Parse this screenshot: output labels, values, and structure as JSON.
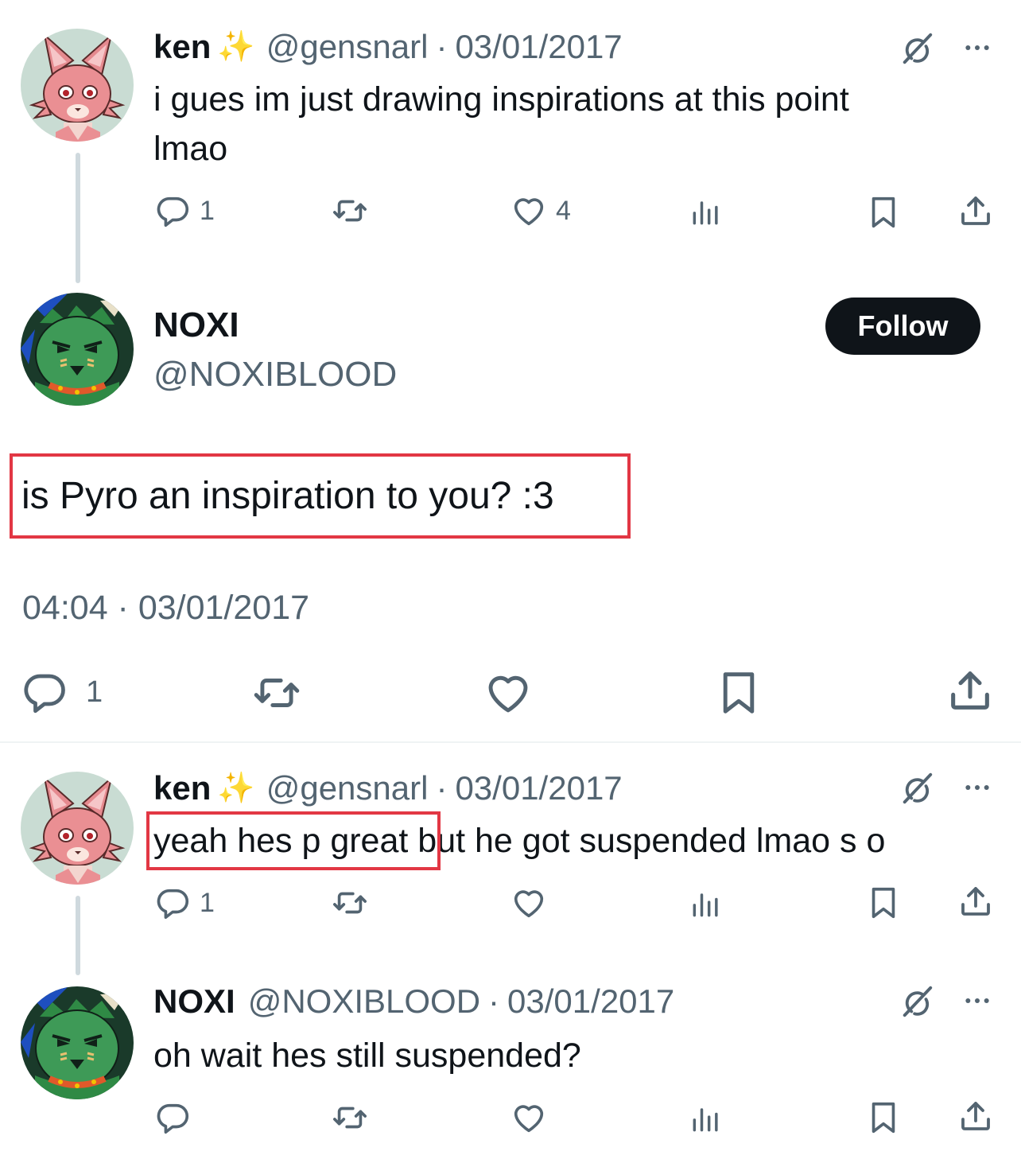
{
  "tweet1": {
    "name": "ken",
    "emoji": "✨",
    "handle": "@gensnarl",
    "dot": "·",
    "date": "03/01/2017",
    "text_line1": "i gues im just drawing inspirations at this point",
    "text_line2": "lmao",
    "replies": "1",
    "likes": "4"
  },
  "main_tweet": {
    "name": "NOXI",
    "handle": "@NOXIBLOOD",
    "follow_label": "Follow",
    "text": "is Pyro an inspiration to you? :3",
    "timestamp": "04:04 · 03/01/2017",
    "replies": "1"
  },
  "tweet3": {
    "name": "ken",
    "emoji": "✨",
    "handle": "@gensnarl",
    "dot": "·",
    "date": "03/01/2017",
    "text_highlight": "yeah hes p great",
    "text_rest": " but he got suspended lmao s o",
    "replies": "1"
  },
  "tweet4": {
    "name": "NOXI",
    "handle": "@NOXIBLOOD",
    "dot": "·",
    "date": "03/01/2017",
    "text": "oh wait hes still suspended?"
  },
  "colors": {
    "text": "#0f1419",
    "secondary": "#536471",
    "highlight_border": "#e23744",
    "thread_line": "#cfd9de"
  }
}
